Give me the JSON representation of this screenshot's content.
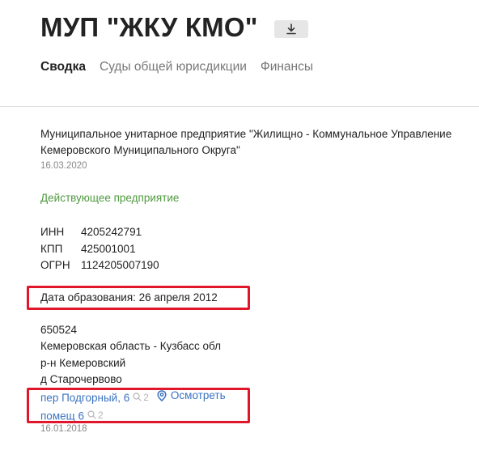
{
  "header": {
    "title": "МУП \"ЖКУ КМО\"",
    "download_icon": "download-icon"
  },
  "tabs": [
    {
      "label": "Сводка",
      "active": true
    },
    {
      "label": "Суды общей юрисдикции",
      "active": false
    },
    {
      "label": "Финансы",
      "active": false
    }
  ],
  "summary": {
    "full_name": "Муниципальное унитарное предприятие \"Жилищно - Коммунальное Управление Кемеровского Муниципального Округа\"",
    "name_date": "16.03.2020",
    "status": "Действующее предприятие",
    "codes": [
      {
        "key": "ИНН",
        "value": "4205242791"
      },
      {
        "key": "КПП",
        "value": "425001001"
      },
      {
        "key": "ОГРН",
        "value": "1124205007190"
      }
    ],
    "founded": "Дата образования: 26 апреля 2012",
    "address": {
      "postcode": "650524",
      "region": "Кемеровская область - Кузбасс обл",
      "district": "р-н Кемеровский",
      "settlement": "д Старочервово",
      "street": "пер Подгорный, 6",
      "street_search_count": "2",
      "inspect_label": "Осмотреть",
      "premises": "помещ 6",
      "premises_search_count": "2",
      "date": "16.01.2018"
    }
  },
  "colors": {
    "accent_link": "#3a73c0",
    "status_green": "#4f9a3f",
    "highlight_red": "#e0162b",
    "muted_gray": "#888888"
  }
}
